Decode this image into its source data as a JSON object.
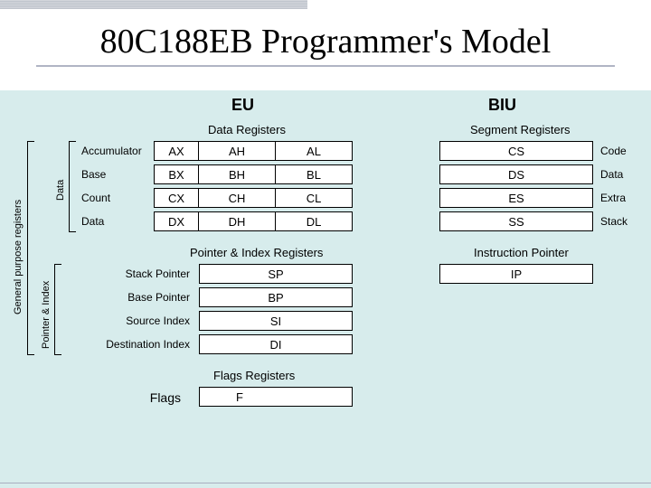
{
  "title": "80C188EB Programmer's Model",
  "eu": {
    "header": "EU",
    "data_registers_title": "Data Registers",
    "rows": [
      {
        "name": "Accumulator",
        "full": "AX",
        "hi": "AH",
        "lo": "AL"
      },
      {
        "name": "Base",
        "full": "BX",
        "hi": "BH",
        "lo": "BL"
      },
      {
        "name": "Count",
        "full": "CX",
        "hi": "CH",
        "lo": "CL"
      },
      {
        "name": "Data",
        "full": "DX",
        "hi": "DH",
        "lo": "DL"
      }
    ],
    "pointer_title": "Pointer & Index Registers",
    "pointers": [
      {
        "name": "Stack Pointer",
        "reg": "SP"
      },
      {
        "name": "Base Pointer",
        "reg": "BP"
      },
      {
        "name": "Source Index",
        "reg": "SI"
      },
      {
        "name": "Destination Index",
        "reg": "DI"
      }
    ],
    "flags_title": "Flags Registers",
    "flags_label": "Flags",
    "flags_reg": "F"
  },
  "biu": {
    "header": "BIU",
    "segment_title": "Segment Registers",
    "rows": [
      {
        "reg": "CS",
        "name": "Code"
      },
      {
        "reg": "DS",
        "name": "Data"
      },
      {
        "reg": "ES",
        "name": "Extra"
      },
      {
        "reg": "SS",
        "name": "Stack"
      }
    ],
    "ip_title": "Instruction Pointer",
    "ip_reg": "IP"
  },
  "side": {
    "gp": "General purpose registers",
    "data": "Data",
    "pi": "Pointer & Index"
  }
}
